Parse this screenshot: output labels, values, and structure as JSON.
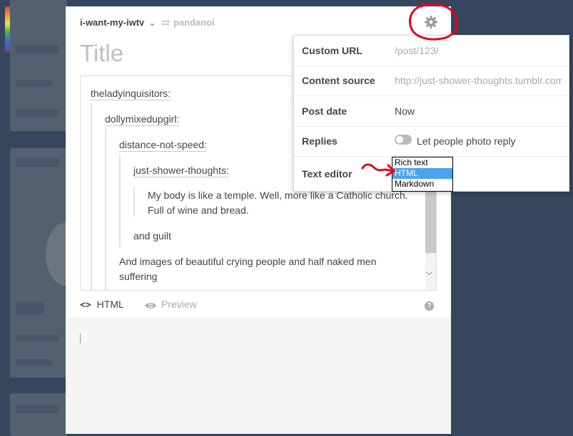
{
  "editor": {
    "blog_name": "i-want-my-iwtv",
    "reblog_source": "pandanoi",
    "title_placeholder": "Title"
  },
  "content": {
    "users": [
      "theladyinquisitors:",
      "dollymixedupgirl:",
      "distance-not-speed:",
      "just-shower-thoughts:"
    ],
    "quote_line1": "My body is like a temple. Well, more like a Catholic church.",
    "quote_line2": "Full of wine and bread.",
    "reply1": "and guilt",
    "reply2_line1": "And images of beautiful crying people and half naked men",
    "reply2_line2": "suffering"
  },
  "tabs": {
    "html_code": "<>",
    "html_label": "HTML",
    "preview_label": "Preview",
    "help": "?"
  },
  "settings": {
    "custom_url_label": "Custom URL",
    "custom_url_placeholder": "/post/123/",
    "content_source_label": "Content source",
    "content_source_placeholder": "http://just-shower-thoughts.tumblr.com",
    "post_date_label": "Post date",
    "post_date_value": "Now",
    "replies_label": "Replies",
    "replies_option": "Let people photo reply",
    "text_editor_label": "Text editor"
  },
  "dropdown": {
    "options": [
      "Rich text",
      "HTML",
      "Markdown"
    ],
    "selected": "HTML"
  },
  "annotation_color": "#e8001c"
}
